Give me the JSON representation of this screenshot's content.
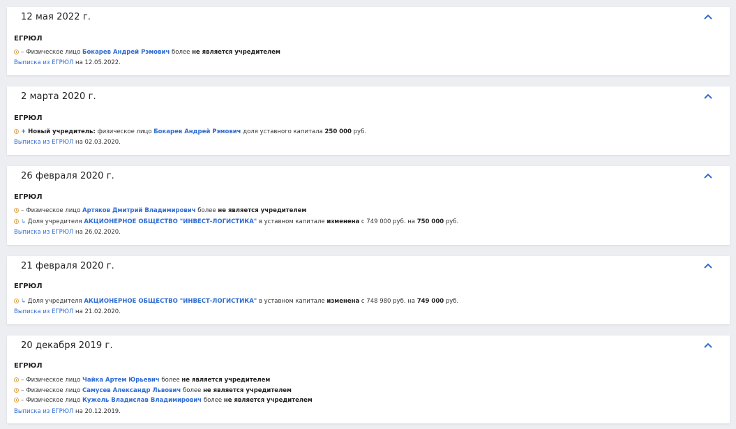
{
  "cards": [
    {
      "date": "12 мая 2022 г.",
      "source": "ЕГРЮЛ",
      "events": [
        {
          "prefix": "Физическое лицо",
          "link": "Бокарев Андрей Рэмович",
          "middle": "более",
          "bold": "не является учредителем"
        }
      ],
      "extract_link": "Выписка из ЕГРЮЛ",
      "extract_date": "на 12.05.2022."
    },
    {
      "date": "2 марта 2020 г.",
      "source": "ЕГРЮЛ",
      "events": [
        {
          "lead_bold": "Новый учредитель:",
          "prefix": "физическое лицо",
          "link": "Бокарев Андрей Рэмович",
          "middle": "доля уставного капитала",
          "bold": "250 000",
          "suffix": "руб."
        }
      ],
      "extract_link": "Выписка из ЕГРЮЛ",
      "extract_date": "на 02.03.2020."
    },
    {
      "date": "26 февраля 2020 г.",
      "source": "ЕГРЮЛ",
      "events": [
        {
          "prefix": "Физическое лицо",
          "link": "Артяков Дмитрий Владимирович",
          "middle": "более",
          "bold": "не является учредителем"
        },
        {
          "prefix": "Доля учредителя",
          "link": "АКЦИОНЕРНОЕ ОБЩЕСТВО \"ИНВЕСТ-ЛОГИСТИКА\"",
          "middle": "в уставном капитале",
          "bold": "изменена",
          "from": "с 749 000 руб. на",
          "to": "750 000",
          "suffix": "руб."
        }
      ],
      "extract_link": "Выписка из ЕГРЮЛ",
      "extract_date": "на 26.02.2020."
    },
    {
      "date": "21 февраля 2020 г.",
      "source": "ЕГРЮЛ",
      "events": [
        {
          "prefix": "Доля учредителя",
          "link": "АКЦИОНЕРНОЕ ОБЩЕСТВО \"ИНВЕСТ-ЛОГИСТИКА\"",
          "middle": "в уставном капитале",
          "bold": "изменена",
          "from": "с 748 980 руб. на",
          "to": "749 000",
          "suffix": "руб."
        }
      ],
      "extract_link": "Выписка из ЕГРЮЛ",
      "extract_date": "на 21.02.2020."
    },
    {
      "date": "20 декабря 2019 г.",
      "source": "ЕГРЮЛ",
      "events": [
        {
          "prefix": "Физическое лицо",
          "link": "Чайка Артем Юрьевич",
          "middle": "более",
          "bold": "не является учредителем"
        },
        {
          "prefix": "Физическое лицо",
          "link": "Самусев Александр Львович",
          "middle": "более",
          "bold": "не является учредителем"
        },
        {
          "prefix": "Физическое лицо",
          "link": "Кужель Владислав Владимирович",
          "middle": "более",
          "bold": "не является учредителем"
        }
      ],
      "extract_link": "Выписка из ЕГРЮЛ",
      "extract_date": "на 20.12.2019."
    }
  ],
  "icons": {
    "collapse": "chevron-up-icon",
    "info": "info-icon",
    "removed": "minus-icon",
    "added": "plus-icon",
    "changed": "swap-arrow-icon"
  },
  "colors": {
    "accent": "#2f6bd1",
    "info": "#e0a44a",
    "background": "#eceef2"
  }
}
